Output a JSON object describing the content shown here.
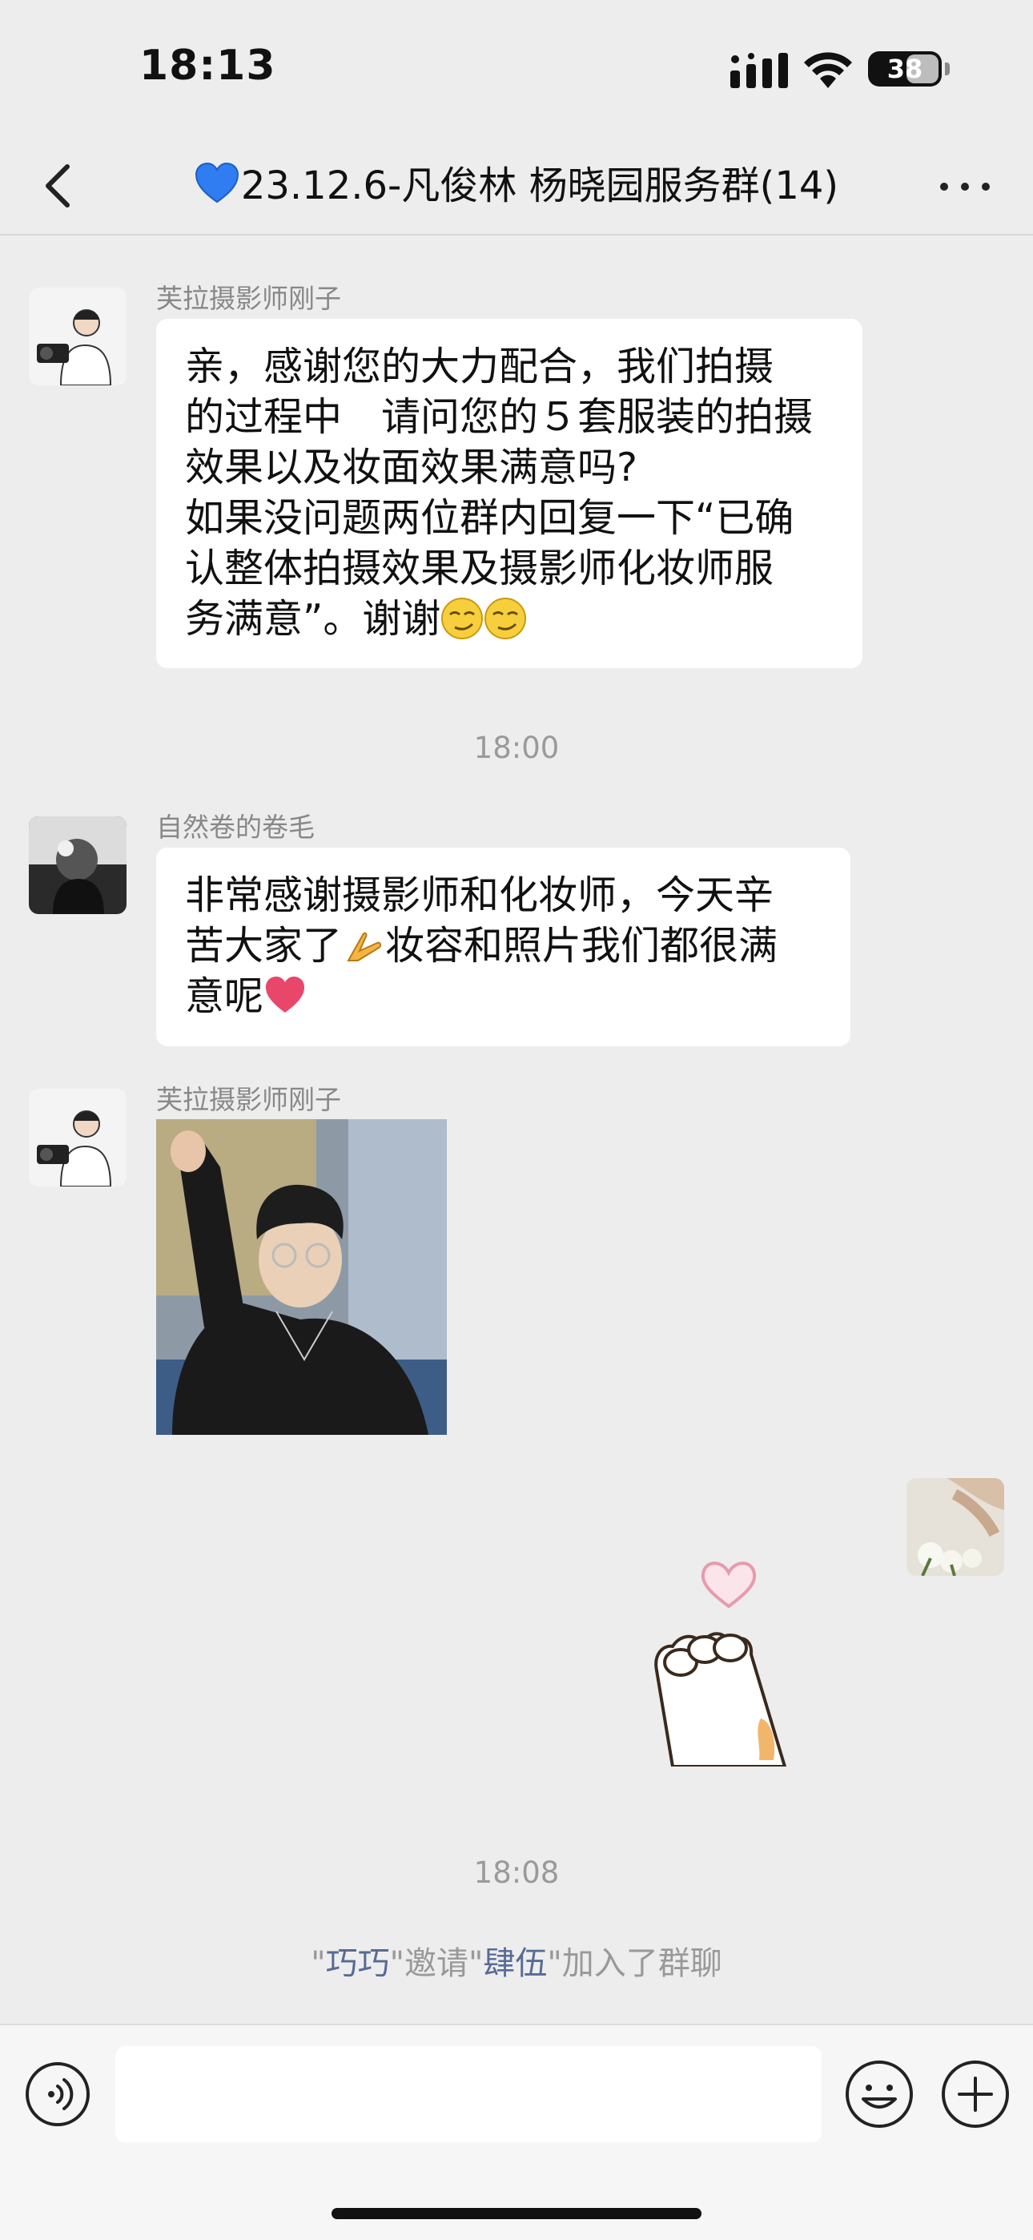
{
  "status_bar": {
    "time": "18:13",
    "battery": "38"
  },
  "nav": {
    "title": "23.12.6-凡俊林 杨晓园服务群(14)",
    "title_emoji": "blue-heart-emoji"
  },
  "messages": [
    {
      "sender": "芙拉摄影师刚子",
      "lines": [
        "亲，感谢您的大力配合，我们拍摄",
        "的过程中　请问您的５套服装的拍摄",
        "效果以及妆面效果满意吗?",
        "如果没问题两位群内回复一下“已确",
        "认整体拍摄效果及摄影师化妆师服",
        "务满意”。谢谢"
      ],
      "trailing_emojis": [
        "smirk-emoji",
        "smirk-emoji"
      ]
    },
    {
      "sender": "自然卷的卷毛",
      "lines": [
        "非常感谢摄影师和化妆师，今天辛",
        "苦大家了",
        "意呢"
      ],
      "line2_suffix": "妆容和照片我们都很满",
      "inline_emojis": [
        "praying-hands-emoji",
        "red-heart-emoji"
      ]
    },
    {
      "sender": "芙拉摄影师刚子",
      "type": "image",
      "image_desc": "pointing-man-photo"
    },
    {
      "sender": "me",
      "type": "sticker",
      "sticker_desc": "paw-heart-sticker"
    }
  ],
  "timestamps": [
    "18:00",
    "18:08"
  ],
  "system_message": {
    "quote1": "\"",
    "inviter": "巧巧",
    "mid": "\"邀请\"",
    "invitee": "肆伍",
    "tail": "\"加入了群聊"
  },
  "input": {
    "placeholder": ""
  },
  "colors": {
    "background": "#ededed",
    "bubble": "#ffffff",
    "link_name": "#576b95",
    "timestamp": "#9a9a9a"
  }
}
